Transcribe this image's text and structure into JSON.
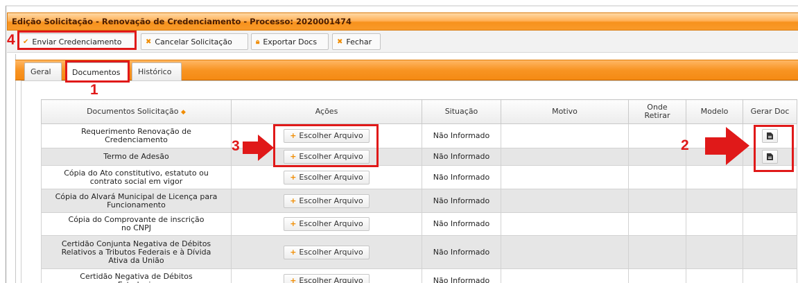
{
  "window": {
    "title": "Edição Solicitação - Renovação de Credenciamento - Processo: 2020001474"
  },
  "toolbar": {
    "send_label": "Enviar Credenciamento",
    "cancel_label": "Cancelar Solicitação",
    "export_label": "Exportar Docs",
    "close_label": "Fechar"
  },
  "tabs": [
    {
      "label": "Geral"
    },
    {
      "label": "Documentos"
    },
    {
      "label": "Histórico"
    }
  ],
  "table": {
    "headers": {
      "documentos": "Documentos Solicitação",
      "acoes": "Ações",
      "situacao": "Situação",
      "motivo": "Motivo",
      "onde_retirar": "Onde Retirar",
      "modelo": "Modelo",
      "gerar_doc": "Gerar Doc"
    },
    "button_label": "Escolher Arquivo",
    "rows": [
      {
        "documento": "Requerimento Renovação de Credenciamento",
        "situacao": "Não Informado"
      },
      {
        "documento": "Termo de Adesão",
        "situacao": "Não Informado"
      },
      {
        "documento": "Cópia do Ato constitutivo, estatuto ou contrato social em vigor",
        "situacao": "Não Informado"
      },
      {
        "documento": "Cópia do Alvará Municipal de Licença para Funcionamento",
        "situacao": "Não Informado"
      },
      {
        "documento": "Cópia do Comprovante de inscrição no CNPJ",
        "situacao": "Não Informado"
      },
      {
        "documento": "Certidão Conjunta Negativa de Débitos Relativos a Tributos Federais e à Dívida Ativa da União",
        "situacao": "Não Informado"
      },
      {
        "documento": "Certidão Negativa de Débitos Estaduais",
        "situacao": "Não Informado"
      }
    ]
  },
  "annotations": {
    "n1": "1",
    "n2": "2",
    "n3": "3",
    "n4": "4"
  },
  "colors": {
    "accent": "#f58a13",
    "annotation": "#e01919"
  }
}
